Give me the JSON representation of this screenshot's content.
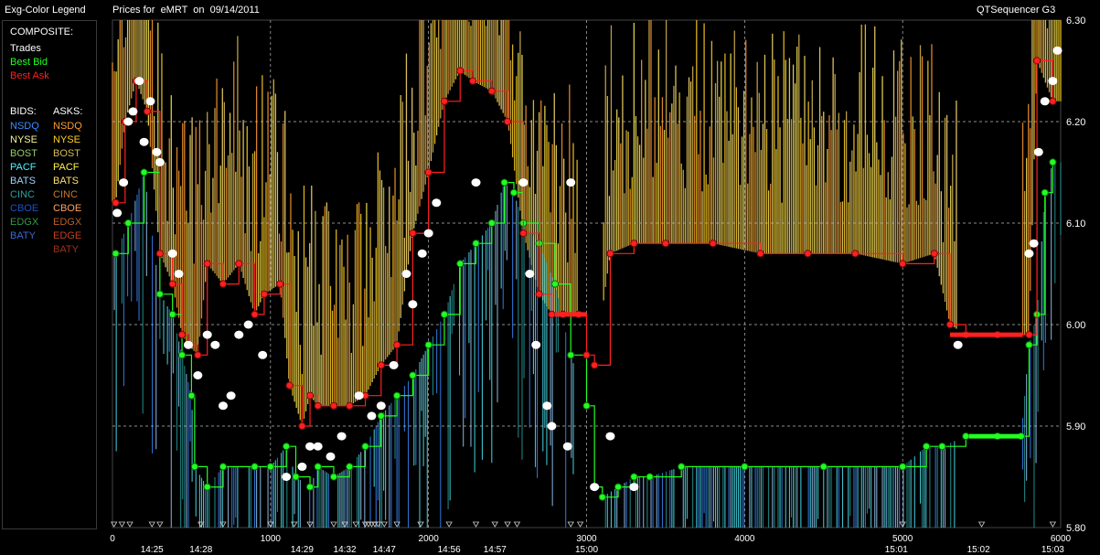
{
  "header": {
    "legend_title": "Exg-Color Legend",
    "chart_title": "Prices for  eMRT  on  09/14/2011",
    "app_name": "QTSequencer G3"
  },
  "legend": {
    "composite_label": "COMPOSITE:",
    "composite": [
      {
        "label": "Trades",
        "color": "#ffffff"
      },
      {
        "label": "Best Bid",
        "color": "#22ff22"
      },
      {
        "label": "Best Ask",
        "color": "#ff2020"
      }
    ],
    "bids_label": "BIDS:",
    "asks_label": "ASKS:",
    "bids": [
      {
        "label": "NSDQ",
        "color": "#3a8cff"
      },
      {
        "label": "NYSE",
        "color": "#f2f29a"
      },
      {
        "label": "BOST",
        "color": "#8fcf6a"
      },
      {
        "label": "PACF",
        "color": "#50f0ff"
      },
      {
        "label": "BATS",
        "color": "#9fd0ff"
      },
      {
        "label": "CINC",
        "color": "#2aa0a0"
      },
      {
        "label": "CBOE",
        "color": "#2050c0"
      },
      {
        "label": "EDGX",
        "color": "#2f9a4a"
      },
      {
        "label": "BATY",
        "color": "#3a6ad8"
      }
    ],
    "asks": [
      {
        "label": "NSDQ",
        "color": "#ff9a30"
      },
      {
        "label": "NYSE",
        "color": "#ffd020"
      },
      {
        "label": "BOST",
        "color": "#d8b850"
      },
      {
        "label": "PACF",
        "color": "#ffee55"
      },
      {
        "label": "BATS",
        "color": "#ffe070"
      },
      {
        "label": "CINC",
        "color": "#c87830"
      },
      {
        "label": "CBOE",
        "color": "#ffa060"
      },
      {
        "label": "EDGX",
        "color": "#b86028"
      },
      {
        "label": "EDGE",
        "color": "#c04020"
      },
      {
        "label": "BATY",
        "color": "#a03018"
      }
    ]
  },
  "chart_data": {
    "type": "line",
    "title": "Prices for  eMRT  on  09/14/2011",
    "xlim": [
      0,
      6000
    ],
    "ylim": [
      5.8,
      6.3
    ],
    "x_ticks": [
      "0",
      "1000",
      "2000",
      "3000",
      "4000",
      "5000",
      "6000"
    ],
    "x_tick_values": [
      0,
      1000,
      2000,
      3000,
      4000,
      5000,
      6000
    ],
    "time_labels": [
      "14:25",
      "14:28",
      "14:29",
      "14:32",
      "14:47",
      "14:56",
      "14:57",
      "15:00",
      "15:01",
      "15:02",
      "15:03"
    ],
    "time_label_x": [
      250,
      560,
      1200,
      1470,
      1720,
      2130,
      2420,
      3000,
      4960,
      5480,
      5950
    ],
    "y_ticks": [
      "5.80",
      "5.90",
      "6.00",
      "6.10",
      "6.20",
      "6.30"
    ],
    "y_tick_values": [
      5.8,
      5.9,
      6.0,
      6.1,
      6.2,
      6.3
    ],
    "grid": true,
    "series": [
      {
        "name": "Trades",
        "color": "#ffffff",
        "x": [
          30,
          70,
          100,
          130,
          170,
          200,
          240,
          280,
          300,
          380,
          420,
          480,
          540,
          600,
          650,
          700,
          750,
          800,
          860,
          950,
          1100,
          1200,
          1250,
          1300,
          1380,
          1450,
          1560,
          1640,
          1700,
          1780,
          1860,
          1900,
          1960,
          2000,
          2050,
          2300,
          2600,
          2640,
          2680,
          2750,
          2780,
          2880,
          2900,
          3050,
          3150,
          3300,
          5350,
          5800,
          5830,
          5860,
          5900,
          5950,
          5980
        ],
        "y": [
          6.11,
          6.14,
          6.2,
          6.21,
          6.24,
          6.18,
          6.22,
          6.17,
          6.16,
          6.07,
          6.05,
          5.98,
          5.95,
          5.99,
          5.98,
          5.92,
          5.93,
          5.99,
          6.0,
          5.97,
          5.85,
          5.86,
          5.88,
          5.88,
          5.87,
          5.89,
          5.93,
          5.91,
          5.92,
          5.96,
          6.05,
          6.02,
          6.07,
          6.09,
          6.12,
          6.14,
          6.14,
          6.05,
          5.98,
          5.92,
          5.9,
          5.88,
          6.14,
          5.84,
          5.89,
          5.84,
          5.98,
          6.07,
          6.08,
          6.17,
          6.22,
          6.24,
          6.27
        ]
      },
      {
        "name": "Best Bid",
        "color": "#22ff22",
        "x": [
          20,
          100,
          200,
          300,
          380,
          440,
          500,
          520,
          600,
          700,
          900,
          1000,
          1100,
          1160,
          1250,
          1300,
          1400,
          1500,
          1600,
          1700,
          1800,
          1900,
          2000,
          2100,
          2200,
          2300,
          2400,
          2480,
          2540,
          2600,
          2700,
          2800,
          2900,
          3000,
          3050,
          3100,
          3200,
          3300,
          3400,
          3600,
          4000,
          4500,
          5000,
          5150,
          5250,
          5400,
          5600,
          5750,
          5800,
          5850,
          5900,
          5950
        ],
        "y": [
          6.07,
          6.1,
          6.15,
          6.03,
          6.01,
          5.97,
          5.93,
          5.86,
          5.84,
          5.86,
          5.86,
          5.86,
          5.88,
          5.85,
          5.84,
          5.86,
          5.85,
          5.86,
          5.88,
          5.91,
          5.93,
          5.95,
          5.98,
          6.01,
          6.06,
          6.08,
          6.1,
          6.14,
          6.13,
          6.1,
          6.08,
          6.04,
          5.97,
          5.92,
          5.84,
          5.83,
          5.84,
          5.85,
          5.85,
          5.86,
          5.86,
          5.86,
          5.86,
          5.88,
          5.88,
          5.89,
          5.89,
          5.89,
          5.98,
          6.01,
          6.13,
          6.16
        ]
      },
      {
        "name": "Best Ask",
        "color": "#ff2020",
        "x": [
          20,
          80,
          150,
          220,
          300,
          380,
          440,
          480,
          540,
          600,
          700,
          800,
          900,
          960,
          1060,
          1120,
          1200,
          1250,
          1300,
          1400,
          1500,
          1600,
          1700,
          1800,
          1900,
          2000,
          2100,
          2200,
          2280,
          2400,
          2500,
          2600,
          2700,
          2780,
          2850,
          2950,
          3000,
          3050,
          3150,
          3300,
          3500,
          3800,
          4100,
          4400,
          4700,
          5000,
          5200,
          5300,
          5400,
          5600,
          5800,
          5850,
          5950
        ],
        "y": [
          6.12,
          6.2,
          6.24,
          6.21,
          6.07,
          6.04,
          5.99,
          5.98,
          5.97,
          6.06,
          6.04,
          6.06,
          6.01,
          6.03,
          6.04,
          5.94,
          5.9,
          5.93,
          5.92,
          5.92,
          5.92,
          5.93,
          5.96,
          5.98,
          6.09,
          6.15,
          6.22,
          6.25,
          6.24,
          6.23,
          6.2,
          6.09,
          6.03,
          6.01,
          6.01,
          6.01,
          5.97,
          5.96,
          6.07,
          6.08,
          6.08,
          6.08,
          6.07,
          6.07,
          6.07,
          6.06,
          6.07,
          6.0,
          5.99,
          5.99,
          5.99,
          6.26,
          6.22
        ]
      }
    ]
  }
}
